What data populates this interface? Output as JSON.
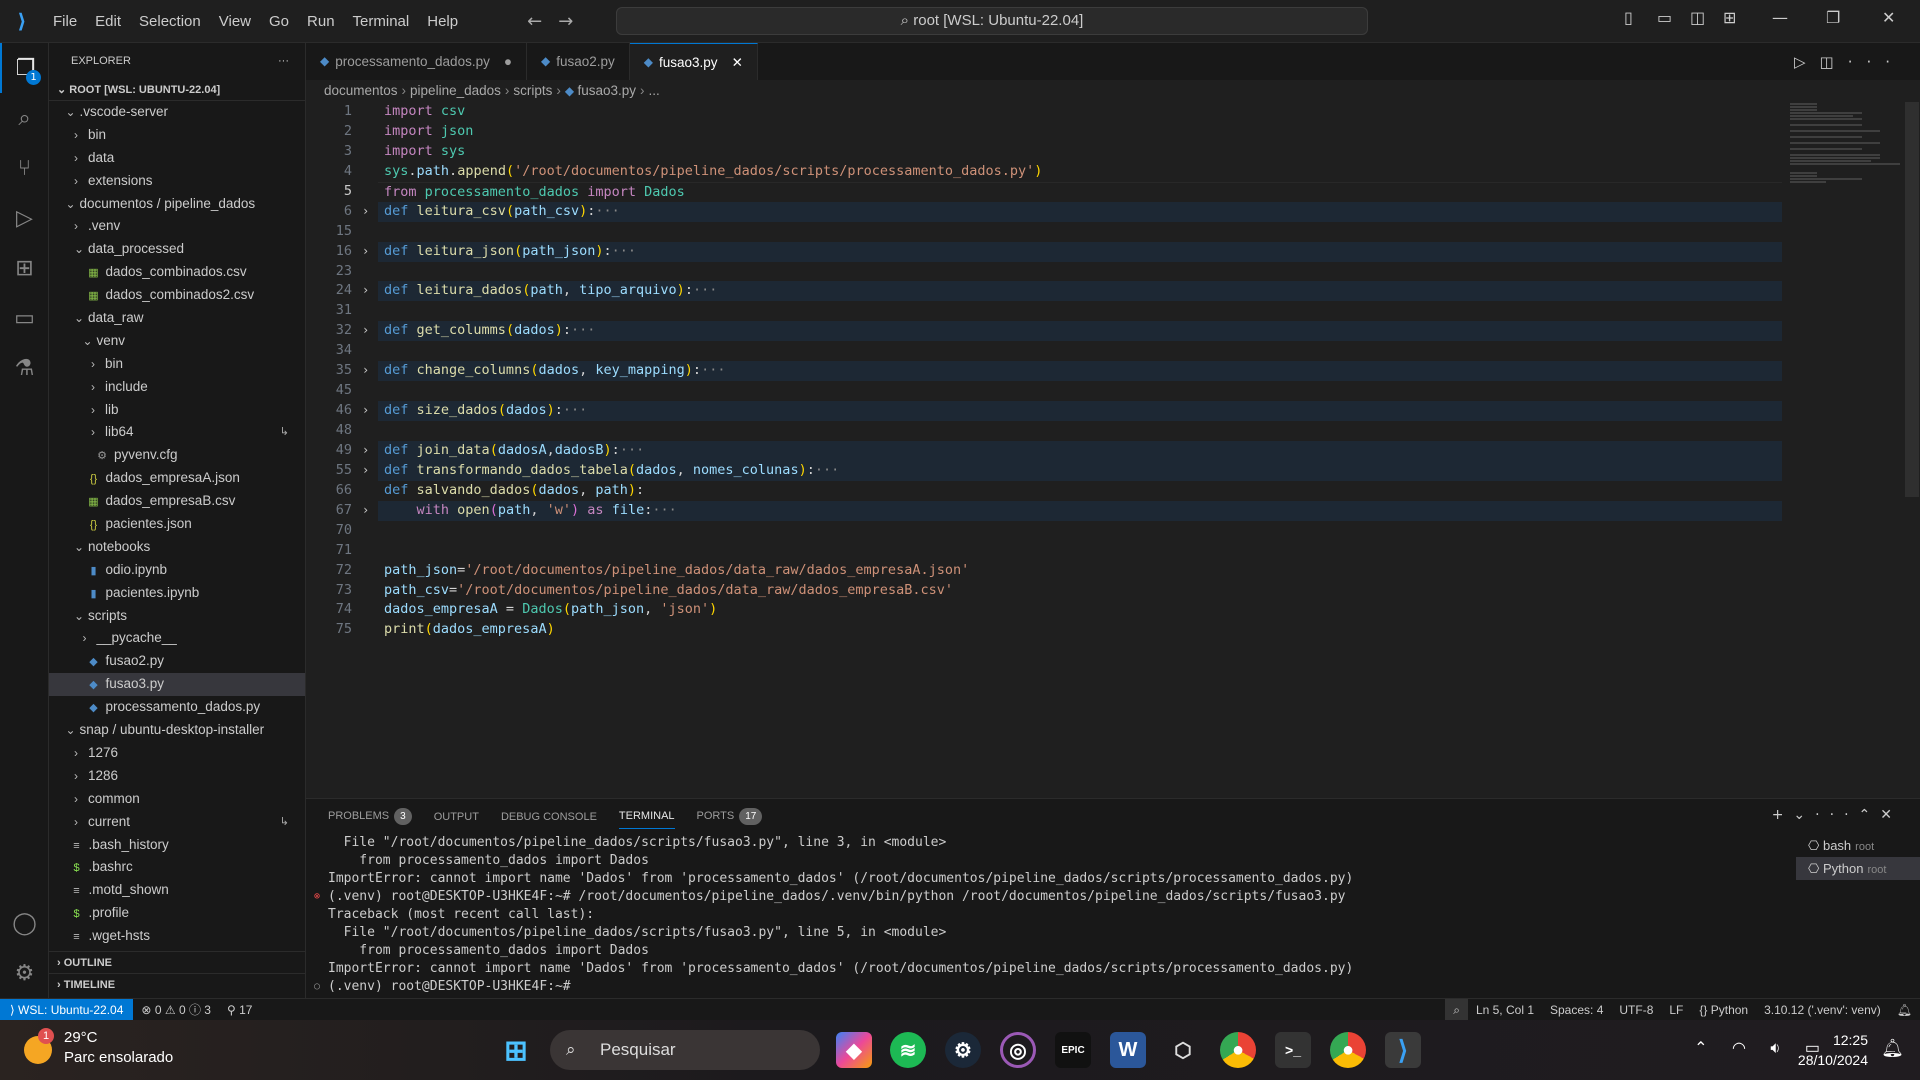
{
  "titlebar": {
    "menus": [
      "File",
      "Edit",
      "Selection",
      "View",
      "Go",
      "Run",
      "Terminal",
      "Help"
    ],
    "command_center": "root [WSL: Ubuntu-22.04]"
  },
  "activity": {
    "explorer_badge": "1"
  },
  "explorer": {
    "title": "EXPLORER",
    "root": "ROOT [WSL: UBUNTU-22.04]",
    "outline": "OUTLINE",
    "timeline": "TIMELINE",
    "items": [
      {
        "label": ".vscode-server",
        "depth": 1,
        "kind": "open"
      },
      {
        "label": "bin",
        "depth": 2,
        "kind": "closed"
      },
      {
        "label": "data",
        "depth": 2,
        "kind": "closed"
      },
      {
        "label": "extensions",
        "depth": 2,
        "kind": "closed"
      },
      {
        "label": "documentos / pipeline_dados",
        "depth": 1,
        "kind": "open"
      },
      {
        "label": ".venv",
        "depth": 2,
        "kind": "closed"
      },
      {
        "label": "data_processed",
        "depth": 2,
        "kind": "open"
      },
      {
        "label": "dados_combinados.csv",
        "depth": 3,
        "kind": "csv"
      },
      {
        "label": "dados_combinados2.csv",
        "depth": 3,
        "kind": "csv"
      },
      {
        "label": "data_raw",
        "depth": 2,
        "kind": "open"
      },
      {
        "label": "venv",
        "depth": 3,
        "kind": "open"
      },
      {
        "label": "bin",
        "depth": 4,
        "kind": "closed"
      },
      {
        "label": "include",
        "depth": 4,
        "kind": "closed"
      },
      {
        "label": "lib",
        "depth": 4,
        "kind": "closed"
      },
      {
        "label": "lib64",
        "depth": 4,
        "kind": "closed",
        "symlink": true
      },
      {
        "label": "pyvenv.cfg",
        "depth": 4,
        "kind": "cfg"
      },
      {
        "label": "dados_empresaA.json",
        "depth": 3,
        "kind": "json"
      },
      {
        "label": "dados_empresaB.csv",
        "depth": 3,
        "kind": "csv"
      },
      {
        "label": "pacientes.json",
        "depth": 3,
        "kind": "json"
      },
      {
        "label": "notebooks",
        "depth": 2,
        "kind": "open"
      },
      {
        "label": "odio.ipynb",
        "depth": 3,
        "kind": "nb"
      },
      {
        "label": "pacientes.ipynb",
        "depth": 3,
        "kind": "nb"
      },
      {
        "label": "scripts",
        "depth": 2,
        "kind": "open"
      },
      {
        "label": "__pycache__",
        "depth": 3,
        "kind": "closed"
      },
      {
        "label": "fusao2.py",
        "depth": 3,
        "kind": "py"
      },
      {
        "label": "fusao3.py",
        "depth": 3,
        "kind": "py",
        "selected": true
      },
      {
        "label": "processamento_dados.py",
        "depth": 3,
        "kind": "py"
      },
      {
        "label": "snap / ubuntu-desktop-installer",
        "depth": 1,
        "kind": "open"
      },
      {
        "label": "1276",
        "depth": 2,
        "kind": "closed"
      },
      {
        "label": "1286",
        "depth": 2,
        "kind": "closed"
      },
      {
        "label": "common",
        "depth": 2,
        "kind": "closed"
      },
      {
        "label": "current",
        "depth": 2,
        "kind": "closed",
        "symlink": true
      },
      {
        "label": ".bash_history",
        "depth": 1,
        "kind": "txt"
      },
      {
        "label": ".bashrc",
        "depth": 1,
        "kind": "sh"
      },
      {
        "label": ".motd_shown",
        "depth": 1,
        "kind": "txt"
      },
      {
        "label": ".profile",
        "depth": 1,
        "kind": "sh"
      },
      {
        "label": ".wget-hsts",
        "depth": 1,
        "kind": "txt"
      }
    ]
  },
  "tabs": [
    {
      "label": "processamento_dados.py",
      "modified": true
    },
    {
      "label": "fusao2.py"
    },
    {
      "label": "fusao3.py",
      "active": true
    }
  ],
  "breadcrumb": [
    "documentos",
    "pipeline_dados",
    "scripts",
    "fusao3.py",
    "..."
  ],
  "code": [
    {
      "n": "1",
      "t": [
        [
          "kw",
          "import"
        ],
        [
          "p",
          " "
        ],
        [
          "mod",
          "csv"
        ]
      ]
    },
    {
      "n": "2",
      "t": [
        [
          "kw",
          "import"
        ],
        [
          "p",
          " "
        ],
        [
          "mod",
          "json"
        ]
      ]
    },
    {
      "n": "3",
      "t": [
        [
          "kw",
          "import"
        ],
        [
          "p",
          " "
        ],
        [
          "mod",
          "sys"
        ]
      ]
    },
    {
      "n": "4",
      "t": [
        [
          "mod",
          "sys"
        ],
        [
          "p",
          "."
        ],
        [
          "var",
          "path"
        ],
        [
          "p",
          "."
        ],
        [
          "fn",
          "append"
        ],
        [
          "b1",
          "("
        ],
        [
          "str",
          "'/root/documentos/pipeline_dados/scripts/processamento_dados.py'"
        ],
        [
          "b1",
          ")"
        ]
      ]
    },
    {
      "n": "5",
      "cur": true,
      "t": [
        [
          "kw",
          "from"
        ],
        [
          "p",
          " "
        ],
        [
          "mod",
          "processamento_dados"
        ],
        [
          "p",
          " "
        ],
        [
          "kw",
          "import"
        ],
        [
          "p",
          " "
        ],
        [
          "mod",
          "Dados"
        ]
      ]
    },
    {
      "n": "6",
      "fold": true,
      "t": [
        [
          "def",
          "def"
        ],
        [
          "p",
          " "
        ],
        [
          "fn",
          "leitura_csv"
        ],
        [
          "b1",
          "("
        ],
        [
          "var",
          "path_csv"
        ],
        [
          "b1",
          ")"
        ],
        [
          "p",
          ":"
        ],
        [
          "dots",
          "···"
        ]
      ]
    },
    {
      "n": "15",
      "t": []
    },
    {
      "n": "16",
      "fold": true,
      "t": [
        [
          "def",
          "def"
        ],
        [
          "p",
          " "
        ],
        [
          "fn",
          "leitura_json"
        ],
        [
          "b1",
          "("
        ],
        [
          "var",
          "path_json"
        ],
        [
          "b1",
          ")"
        ],
        [
          "p",
          ":"
        ],
        [
          "dots",
          "···"
        ]
      ]
    },
    {
      "n": "23",
      "t": []
    },
    {
      "n": "24",
      "fold": true,
      "t": [
        [
          "def",
          "def"
        ],
        [
          "p",
          " "
        ],
        [
          "fn",
          "leitura_dados"
        ],
        [
          "b1",
          "("
        ],
        [
          "var",
          "path"
        ],
        [
          "p",
          ", "
        ],
        [
          "var",
          "tipo_arquivo"
        ],
        [
          "b1",
          ")"
        ],
        [
          "p",
          ":"
        ],
        [
          "dots",
          "···"
        ]
      ]
    },
    {
      "n": "31",
      "t": []
    },
    {
      "n": "32",
      "fold": true,
      "t": [
        [
          "def",
          "def"
        ],
        [
          "p",
          " "
        ],
        [
          "fn",
          "get_columms"
        ],
        [
          "b1",
          "("
        ],
        [
          "var",
          "dados"
        ],
        [
          "b1",
          ")"
        ],
        [
          "p",
          ":"
        ],
        [
          "dots",
          "···"
        ]
      ]
    },
    {
      "n": "34",
      "t": []
    },
    {
      "n": "35",
      "fold": true,
      "t": [
        [
          "def",
          "def"
        ],
        [
          "p",
          " "
        ],
        [
          "fn",
          "change_columns"
        ],
        [
          "b1",
          "("
        ],
        [
          "var",
          "dados"
        ],
        [
          "p",
          ", "
        ],
        [
          "var",
          "key_mapping"
        ],
        [
          "b1",
          ")"
        ],
        [
          "p",
          ":"
        ],
        [
          "dots",
          "···"
        ]
      ]
    },
    {
      "n": "45",
      "t": []
    },
    {
      "n": "46",
      "fold": true,
      "t": [
        [
          "def",
          "def"
        ],
        [
          "p",
          " "
        ],
        [
          "fn",
          "size_dados"
        ],
        [
          "b1",
          "("
        ],
        [
          "var",
          "dados"
        ],
        [
          "b1",
          ")"
        ],
        [
          "p",
          ":"
        ],
        [
          "dots",
          "···"
        ]
      ]
    },
    {
      "n": "48",
      "t": []
    },
    {
      "n": "49",
      "fold": true,
      "t": [
        [
          "def",
          "def"
        ],
        [
          "p",
          " "
        ],
        [
          "fn",
          "join_data"
        ],
        [
          "b1",
          "("
        ],
        [
          "var",
          "dadosA"
        ],
        [
          "p",
          ","
        ],
        [
          "var",
          "dadosB"
        ],
        [
          "b1",
          ")"
        ],
        [
          "p",
          ":"
        ],
        [
          "dots",
          "···"
        ]
      ]
    },
    {
      "n": "55",
      "fold": true,
      "t": [
        [
          "def",
          "def"
        ],
        [
          "p",
          " "
        ],
        [
          "fn",
          "transformando_dados_tabela"
        ],
        [
          "b1",
          "("
        ],
        [
          "var",
          "dados"
        ],
        [
          "p",
          ", "
        ],
        [
          "var",
          "nomes_colunas"
        ],
        [
          "b1",
          ")"
        ],
        [
          "p",
          ":"
        ],
        [
          "dots",
          "···"
        ]
      ]
    },
    {
      "n": "66",
      "t": [
        [
          "def",
          "def"
        ],
        [
          "p",
          " "
        ],
        [
          "fn",
          "salvando_dados"
        ],
        [
          "b1",
          "("
        ],
        [
          "var",
          "dados"
        ],
        [
          "p",
          ", "
        ],
        [
          "var",
          "path"
        ],
        [
          "b1",
          ")"
        ],
        [
          "p",
          ":"
        ]
      ]
    },
    {
      "n": "67",
      "fold": true,
      "t": [
        [
          "p",
          "    "
        ],
        [
          "kw",
          "with"
        ],
        [
          "p",
          " "
        ],
        [
          "fn",
          "open"
        ],
        [
          "b2",
          "("
        ],
        [
          "var",
          "path"
        ],
        [
          "p",
          ", "
        ],
        [
          "str",
          "'w'"
        ],
        [
          "b2",
          ")"
        ],
        [
          "p",
          " "
        ],
        [
          "kw",
          "as"
        ],
        [
          "p",
          " "
        ],
        [
          "var",
          "file"
        ],
        [
          "p",
          ":"
        ],
        [
          "dots",
          "···"
        ]
      ]
    },
    {
      "n": "70",
      "t": []
    },
    {
      "n": "71",
      "t": []
    },
    {
      "n": "72",
      "t": [
        [
          "var",
          "path_json"
        ],
        [
          "p",
          "="
        ],
        [
          "str",
          "'/root/documentos/pipeline_dados/data_raw/dados_empresaA.json'"
        ]
      ]
    },
    {
      "n": "73",
      "t": [
        [
          "var",
          "path_csv"
        ],
        [
          "p",
          "="
        ],
        [
          "str",
          "'/root/documentos/pipeline_dados/data_raw/dados_empresaB.csv'"
        ]
      ]
    },
    {
      "n": "74",
      "t": [
        [
          "var",
          "dados_empresaA"
        ],
        [
          "p",
          " = "
        ],
        [
          "mod",
          "Dados"
        ],
        [
          "b1",
          "("
        ],
        [
          "var",
          "path_json"
        ],
        [
          "p",
          ", "
        ],
        [
          "str",
          "'json'"
        ],
        [
          "b1",
          ")"
        ]
      ]
    },
    {
      "n": "75",
      "t": [
        [
          "fn",
          "print"
        ],
        [
          "b1",
          "("
        ],
        [
          "var",
          "dados_empresaA"
        ],
        [
          "b1",
          ")"
        ]
      ]
    }
  ],
  "panel": {
    "tabs": [
      {
        "label": "PROBLEMS",
        "count": "3"
      },
      {
        "label": "OUTPUT"
      },
      {
        "label": "DEBUG CONSOLE"
      },
      {
        "label": "TERMINAL",
        "active": true
      },
      {
        "label": "PORTS",
        "count": "17"
      }
    ],
    "terminal_lines": [
      {
        "text": "  File \"/root/documentos/pipeline_dados/scripts/fusao3.py\", line 3, in <module>"
      },
      {
        "text": "    from processamento_dados import Dados"
      },
      {
        "text": "ImportError: cannot import name 'Dados' from 'processamento_dados' (/root/documentos/pipeline_dados/scripts/processamento_dados.py)"
      },
      {
        "text": "(.venv) root@DESKTOP-U3HKE4F:~# /root/documentos/pipeline_dados/.venv/bin/python /root/documentos/pipeline_dados/scripts/fusao3.py",
        "mark": "error"
      },
      {
        "text": "Traceback (most recent call last):"
      },
      {
        "text": "  File \"/root/documentos/pipeline_dados/scripts/fusao3.py\", line 5, in <module>"
      },
      {
        "text": "    from processamento_dados import Dados"
      },
      {
        "text": "ImportError: cannot import name 'Dados' from 'processamento_dados' (/root/documentos/pipeline_dados/scripts/processamento_dados.py)"
      },
      {
        "text": "(.venv) root@DESKTOP-U3HKE4F:~# ",
        "mark": "idle"
      }
    ],
    "terminals": [
      {
        "name": "bash",
        "user": "root"
      },
      {
        "name": "Python",
        "user": "root",
        "active": true
      }
    ]
  },
  "statusbar": {
    "remote": "WSL: Ubuntu-22.04",
    "errors": "0",
    "warnings": "0",
    "infos": "3",
    "ports": "17",
    "position": "Ln 5, Col 1",
    "spaces": "Spaces: 4",
    "encoding": "UTF-8",
    "eol": "LF",
    "language": "Python",
    "interpreter": "3.10.12 ('.venv': venv)"
  },
  "taskbar": {
    "temp": "29°C",
    "weather": "Parc ensolarado",
    "weather_badge": "1",
    "search": "Pesquisar",
    "time": "12:25",
    "date": "28/10/2024"
  },
  "colors": {
    "accent": "#0078d4",
    "remote": "#0078d4",
    "error": "#f14c4c"
  }
}
